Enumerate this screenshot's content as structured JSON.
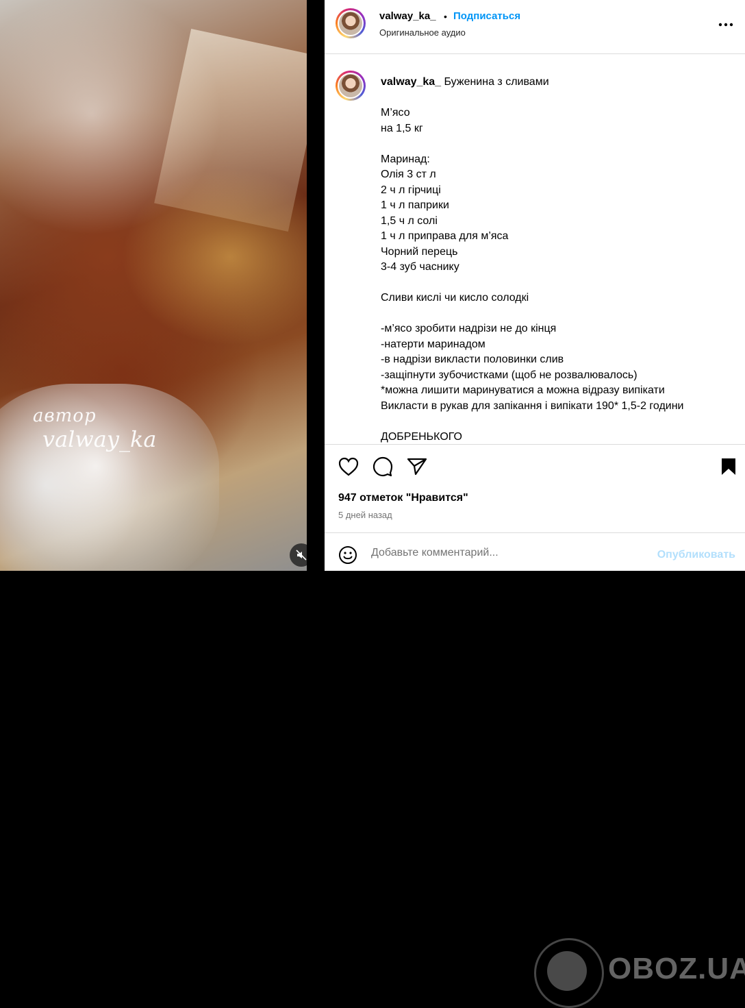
{
  "media": {
    "watermark_author": "автор",
    "watermark_name": "valway_ka",
    "mute_icon": "speaker-muted-icon"
  },
  "header": {
    "username": "valway_ka_",
    "separator": "•",
    "follow_label": "Подписаться",
    "audio_label": "Оригинальное аудио",
    "more_icon": "more-options-icon"
  },
  "caption": {
    "username": "valway_ka_",
    "title": "Буженина з сливами",
    "lines": [
      "М’ясо",
      "на 1,5 кг",
      "",
      "Маринад:",
      "Олія 3 ст л",
      "2 ч л гірчиці",
      "1 ч л паприки",
      "1,5 ч л солі",
      "1 ч л приправа для м’яса",
      "Чорний перець",
      "3-4 зуб часнику",
      "",
      "Сливи кислі чи кисло солодкі",
      "",
      "-м’ясо зробити надрізи не до кінця",
      "-натерти маринадом",
      "-в надрізи викласти половинки слив",
      "-защіпнути зубочистками (щоб не розвалювалось)",
      "*можна лишити маринуватися а можна відразу випікати",
      "Викласти в рукав для запікання і випікати 190* 1,5-2 години",
      "",
      "ДОБРЕНЬКОГО"
    ]
  },
  "actions": {
    "like_icon": "heart-icon",
    "comment_icon": "comment-icon",
    "share_icon": "send-icon",
    "save_icon": "bookmark-icon",
    "likes_text": "947 отметок \"Нравится\"",
    "time_ago": "5 дней назад"
  },
  "comment": {
    "emoji_icon": "emoji-icon",
    "placeholder": "Добавьте комментарий...",
    "publish_label": "Опубликовать"
  },
  "overlay_watermark": {
    "text": "OBOZ.UA"
  },
  "colors": {
    "accent": "#0095f6",
    "publish_disabled": "#b2dffc",
    "border": "#dbdbdb",
    "muted_text": "#737373"
  }
}
